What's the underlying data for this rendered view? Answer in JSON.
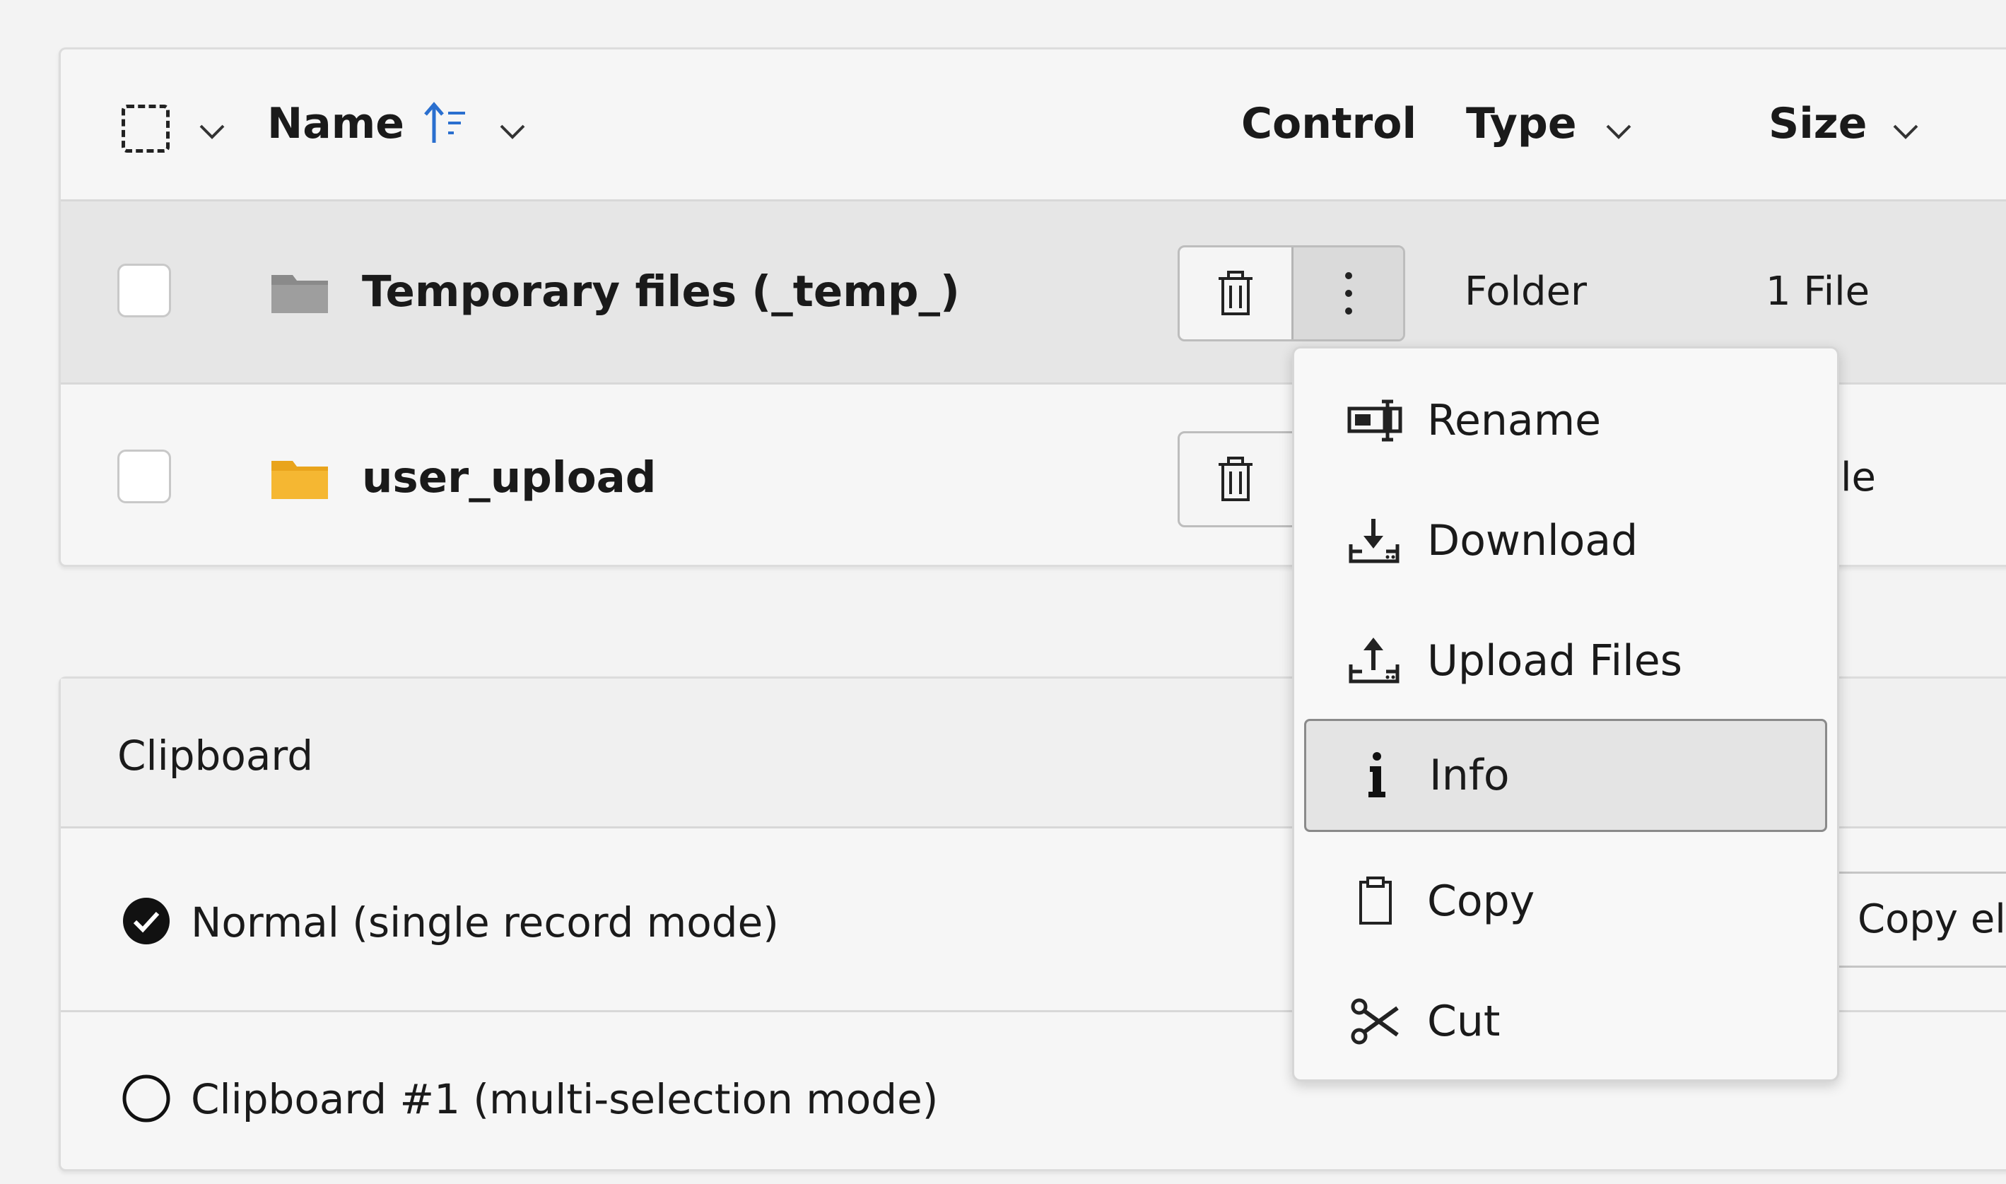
{
  "header": {
    "name_label": "Name",
    "control_label": "Control",
    "type_label": "Type",
    "size_label": "Size"
  },
  "files": [
    {
      "name": "Temporary files (_temp_)",
      "type": "Folder",
      "size": "1 File",
      "icon": "folder-icon-gray"
    },
    {
      "name": "user_upload",
      "type": "",
      "size": "le",
      "icon": "folder-icon-yellow"
    }
  ],
  "context_menu": {
    "items": [
      {
        "label": "Rename",
        "icon": "rename-icon"
      },
      {
        "label": "Download",
        "icon": "download-icon"
      },
      {
        "label": "Upload Files",
        "icon": "upload-icon"
      },
      {
        "label": "Info",
        "icon": "info-icon",
        "active": true
      },
      {
        "label": "Copy",
        "icon": "clipboard-icon"
      },
      {
        "label": "Cut",
        "icon": "scissors-icon"
      }
    ]
  },
  "clipboard": {
    "title": "Clipboard",
    "modes": [
      {
        "label": "Normal (single record mode)",
        "checked": true
      },
      {
        "label": "Clipboard #1 (multi-selection mode)",
        "checked": false
      }
    ],
    "copy_button_label": "Copy ele"
  },
  "colors": {
    "accent_blue": "#2a6fcf",
    "folder_gray": "#8a8a8a",
    "folder_yellow": "#f5b732",
    "row_highlight": "#e6e6e6"
  }
}
